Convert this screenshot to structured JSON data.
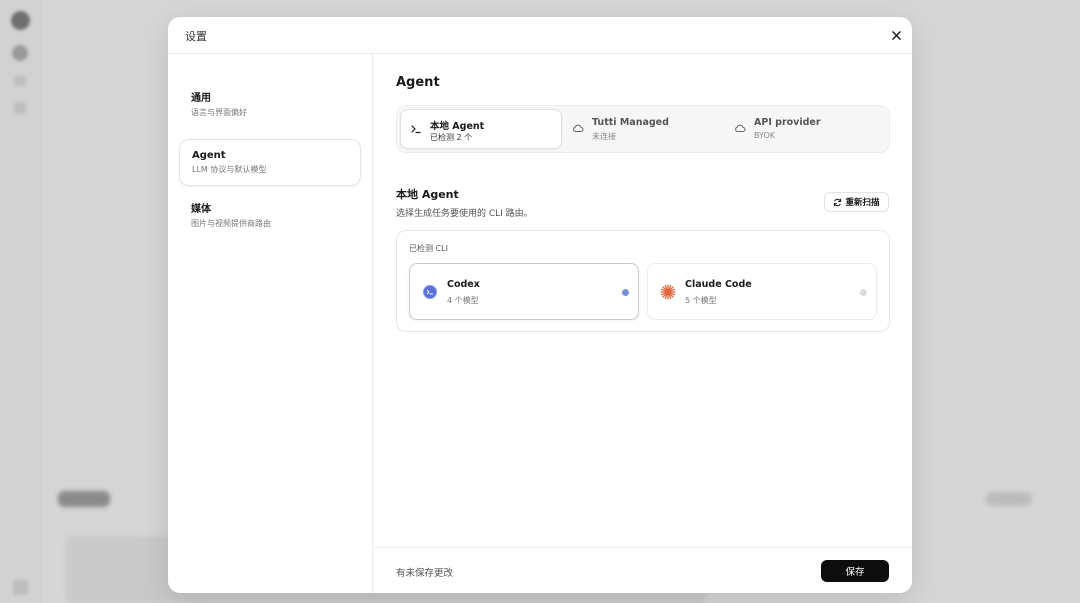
{
  "modal": {
    "title": "设置"
  },
  "sidebar": {
    "items": [
      {
        "title": "通用",
        "subtitle": "语言与界面偏好",
        "active": false
      },
      {
        "title": "Agent",
        "subtitle": "LLM 协议与默认模型",
        "active": true
      },
      {
        "title": "媒体",
        "subtitle": "图片与视频提供商路由",
        "active": false
      }
    ]
  },
  "main": {
    "title": "Agent",
    "segments": [
      {
        "label": "本地 Agent",
        "sub": "已检测 2 个",
        "icon": "terminal-icon",
        "active": true
      },
      {
        "label": "Tutti Managed",
        "sub": "未连接",
        "icon": "cloud-icon",
        "active": false
      },
      {
        "label": "API provider",
        "sub": "BYOK",
        "icon": "cloud-icon",
        "active": false
      }
    ],
    "local": {
      "title": "本地 Agent",
      "description": "选择生成任务要使用的 CLI 路由。",
      "rescan_label": "重新扫描"
    },
    "detected": {
      "label": "已检测 CLI",
      "clis": [
        {
          "name": "Codex",
          "models": "4 个模型",
          "icon": "codex-icon",
          "selected": true,
          "status_color": "#7b8fd6"
        },
        {
          "name": "Claude Code",
          "models": "5 个模型",
          "icon": "claude-icon",
          "selected": false,
          "status_color": "#dcdcdc"
        }
      ]
    }
  },
  "footer": {
    "status": "有未保存更改",
    "save_label": "保存"
  },
  "colors": {
    "accent_button": "#0d0d0d",
    "claude_orange": "#e2643c",
    "codex_blue": "#5b6fd6"
  }
}
